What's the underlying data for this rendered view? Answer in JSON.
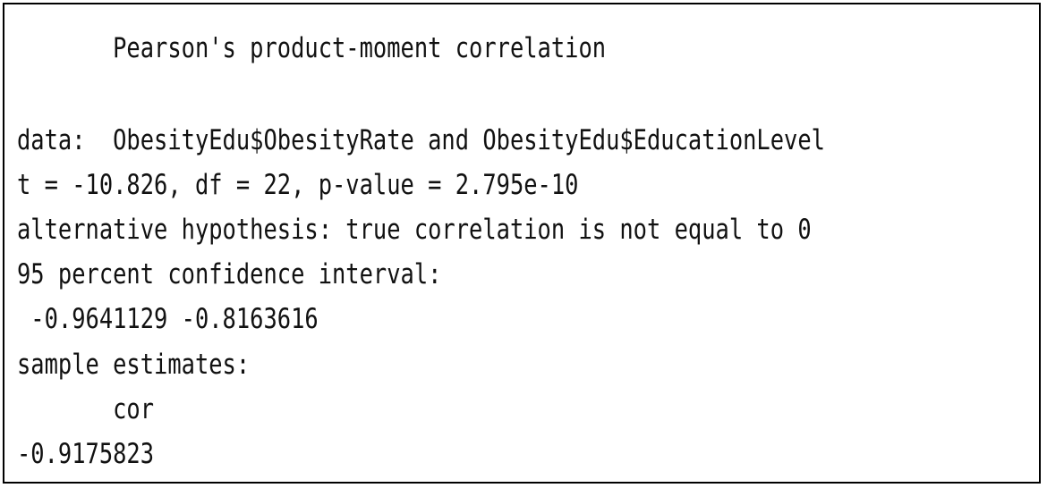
{
  "output": {
    "title": "       Pearson's product-moment correlation",
    "data_line": "data:  ObesityEdu$ObesityRate and ObesityEdu$EducationLevel",
    "stat_line": "t = -10.826, df = 22, p-value = 2.795e-10",
    "alternative_line": "alternative hypothesis: true correlation is not equal to 0",
    "ci_label": "95 percent confidence interval:",
    "ci_values": " -0.9641129 -0.8163616",
    "estimates_label": "sample estimates:",
    "estimate_name": "       cor",
    "estimate_value": "-0.9175823"
  }
}
